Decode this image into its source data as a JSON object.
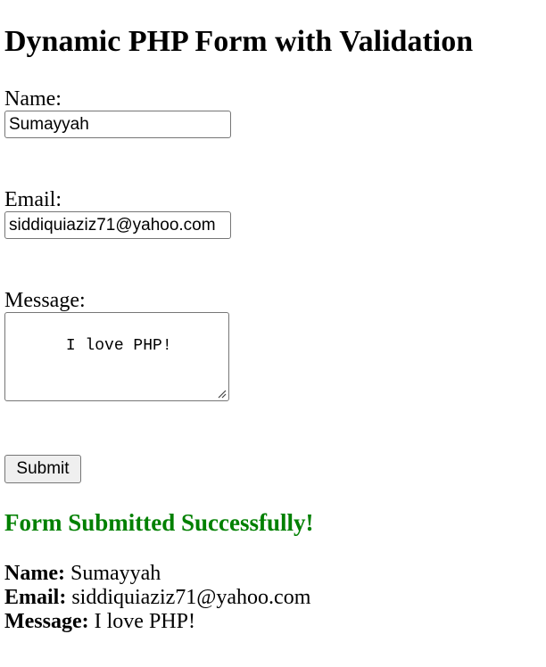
{
  "page": {
    "title": "Dynamic PHP Form with Validation"
  },
  "form": {
    "name_label": "Name:",
    "name_value": "Sumayyah",
    "email_label": "Email:",
    "email_value": "siddiquiaziz71@yahoo.com",
    "message_label": "Message:",
    "message_value": "I love PHP!",
    "submit_label": "Submit"
  },
  "result": {
    "heading": "Form Submitted Successfully!",
    "heading_color": "#008000",
    "name_label": "Name:",
    "name_value": "Sumayyah",
    "email_label": "Email:",
    "email_value": "siddiquiaziz71@yahoo.com",
    "message_label": "Message:",
    "message_value": "I love PHP!"
  }
}
